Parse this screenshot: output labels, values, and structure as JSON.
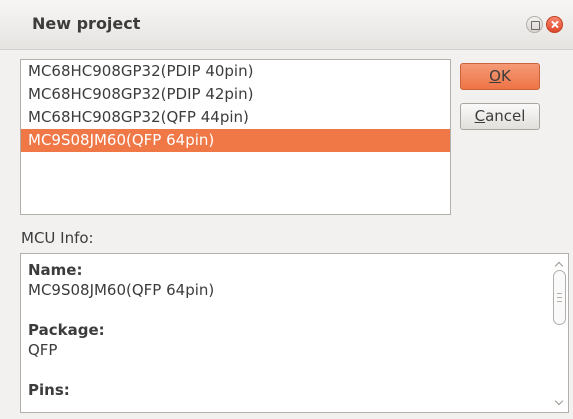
{
  "window": {
    "title": "New project"
  },
  "mcu_list": {
    "items": [
      {
        "label": "MC68HC908GP32(PDIP 40pin)",
        "selected": false
      },
      {
        "label": "MC68HC908GP32(PDIP 42pin)",
        "selected": false
      },
      {
        "label": "MC68HC908GP32(QFP 44pin)",
        "selected": false
      },
      {
        "label": "MC9S08JM60(QFP 64pin)",
        "selected": true
      }
    ]
  },
  "buttons": {
    "ok_label": "OK",
    "ok_mnemonic": "O",
    "ok_rest": "K",
    "cancel_label": "Cancel",
    "cancel_mnemonic": "C",
    "cancel_rest": "ancel"
  },
  "mcu_info": {
    "label": "MCU Info:",
    "name_label": "Name:",
    "name_value": "MC9S08JM60(QFP 64pin)",
    "package_label": "Package:",
    "package_value": "QFP",
    "pins_label": "Pins:"
  },
  "colors": {
    "selection": "#f07746",
    "ok_button": "#ee7446",
    "close_button": "#e0482c"
  }
}
